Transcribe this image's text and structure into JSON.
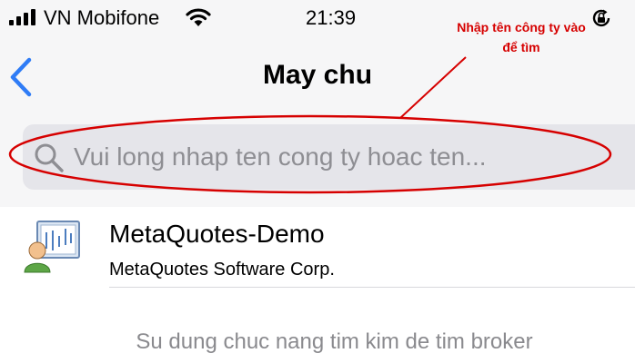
{
  "status_bar": {
    "carrier": "VN Mobifone",
    "time": "21:39",
    "signal_icon": "signal-bars-icon",
    "wifi_icon": "wifi-icon",
    "orientation_lock_icon": "orientation-lock-icon"
  },
  "nav": {
    "back_icon": "chevron-left-icon",
    "title": "May chu"
  },
  "search": {
    "placeholder": "Vui long nhap ten cong ty hoac ten...",
    "value": ""
  },
  "annotation": {
    "text": "Nhập tên công ty vào để tìm",
    "color": "#d60000"
  },
  "servers": [
    {
      "name": "MetaQuotes-Demo",
      "company": "MetaQuotes Software Corp.",
      "icon": "metaquotes-server-icon"
    }
  ],
  "hint": "Su dung chuc nang tim kim de tim broker",
  "colors": {
    "accent": "#2f7cf6",
    "header_bg": "#f6f6f7",
    "search_bg": "#e5e5ea",
    "annotation": "#d60000"
  }
}
